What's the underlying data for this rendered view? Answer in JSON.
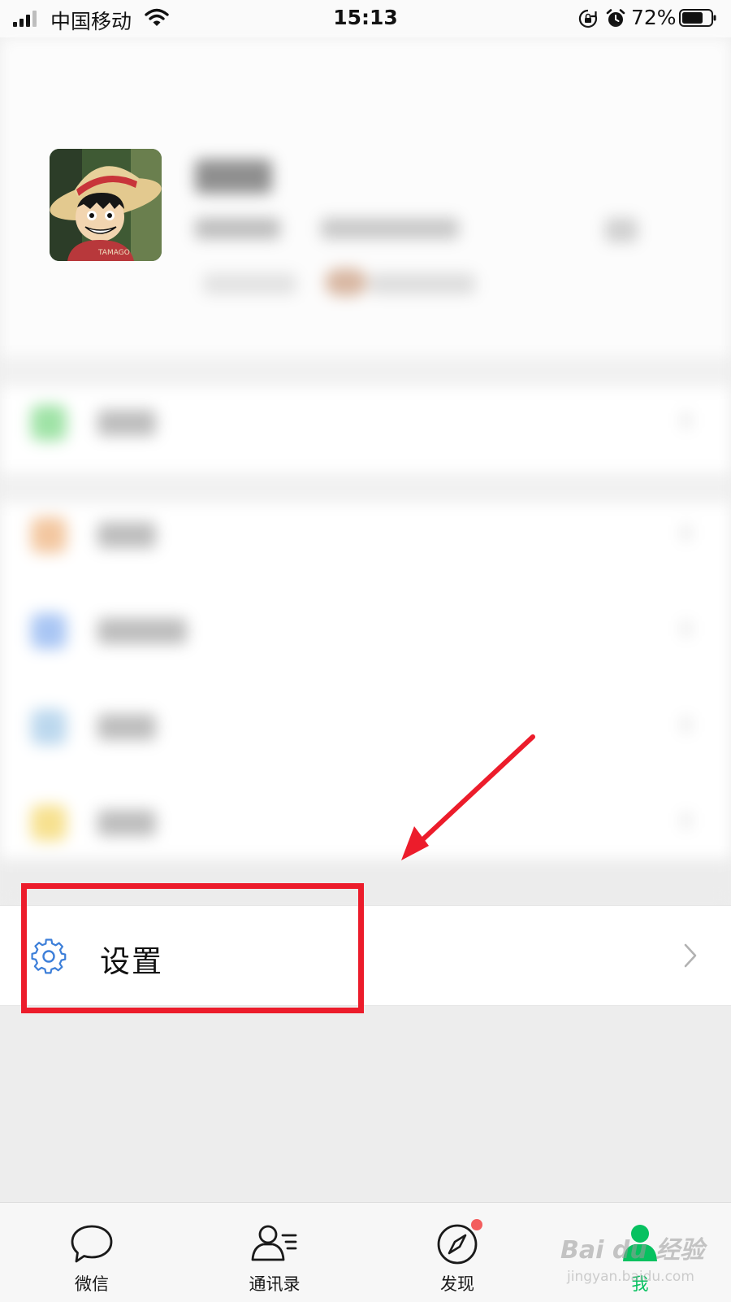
{
  "status_bar": {
    "carrier": "中国移动",
    "time": "15:13",
    "battery": "72%"
  },
  "settings": {
    "label": "设置"
  },
  "tab_bar": {
    "tabs": [
      {
        "label": "微信",
        "icon": "chat-bubble-icon"
      },
      {
        "label": "通讯录",
        "icon": "contacts-icon"
      },
      {
        "label": "发现",
        "icon": "compass-icon",
        "badge": true
      },
      {
        "label": "我",
        "icon": "profile-icon",
        "active": true
      }
    ]
  },
  "watermark": {
    "main": "Bai du 经验",
    "sub": "jingyan.baidu.com"
  },
  "colors": {
    "accent": "#07c160",
    "highlight": "#ec1c2b",
    "gear": "#3d7fd9",
    "badge": "#f35d5d"
  }
}
